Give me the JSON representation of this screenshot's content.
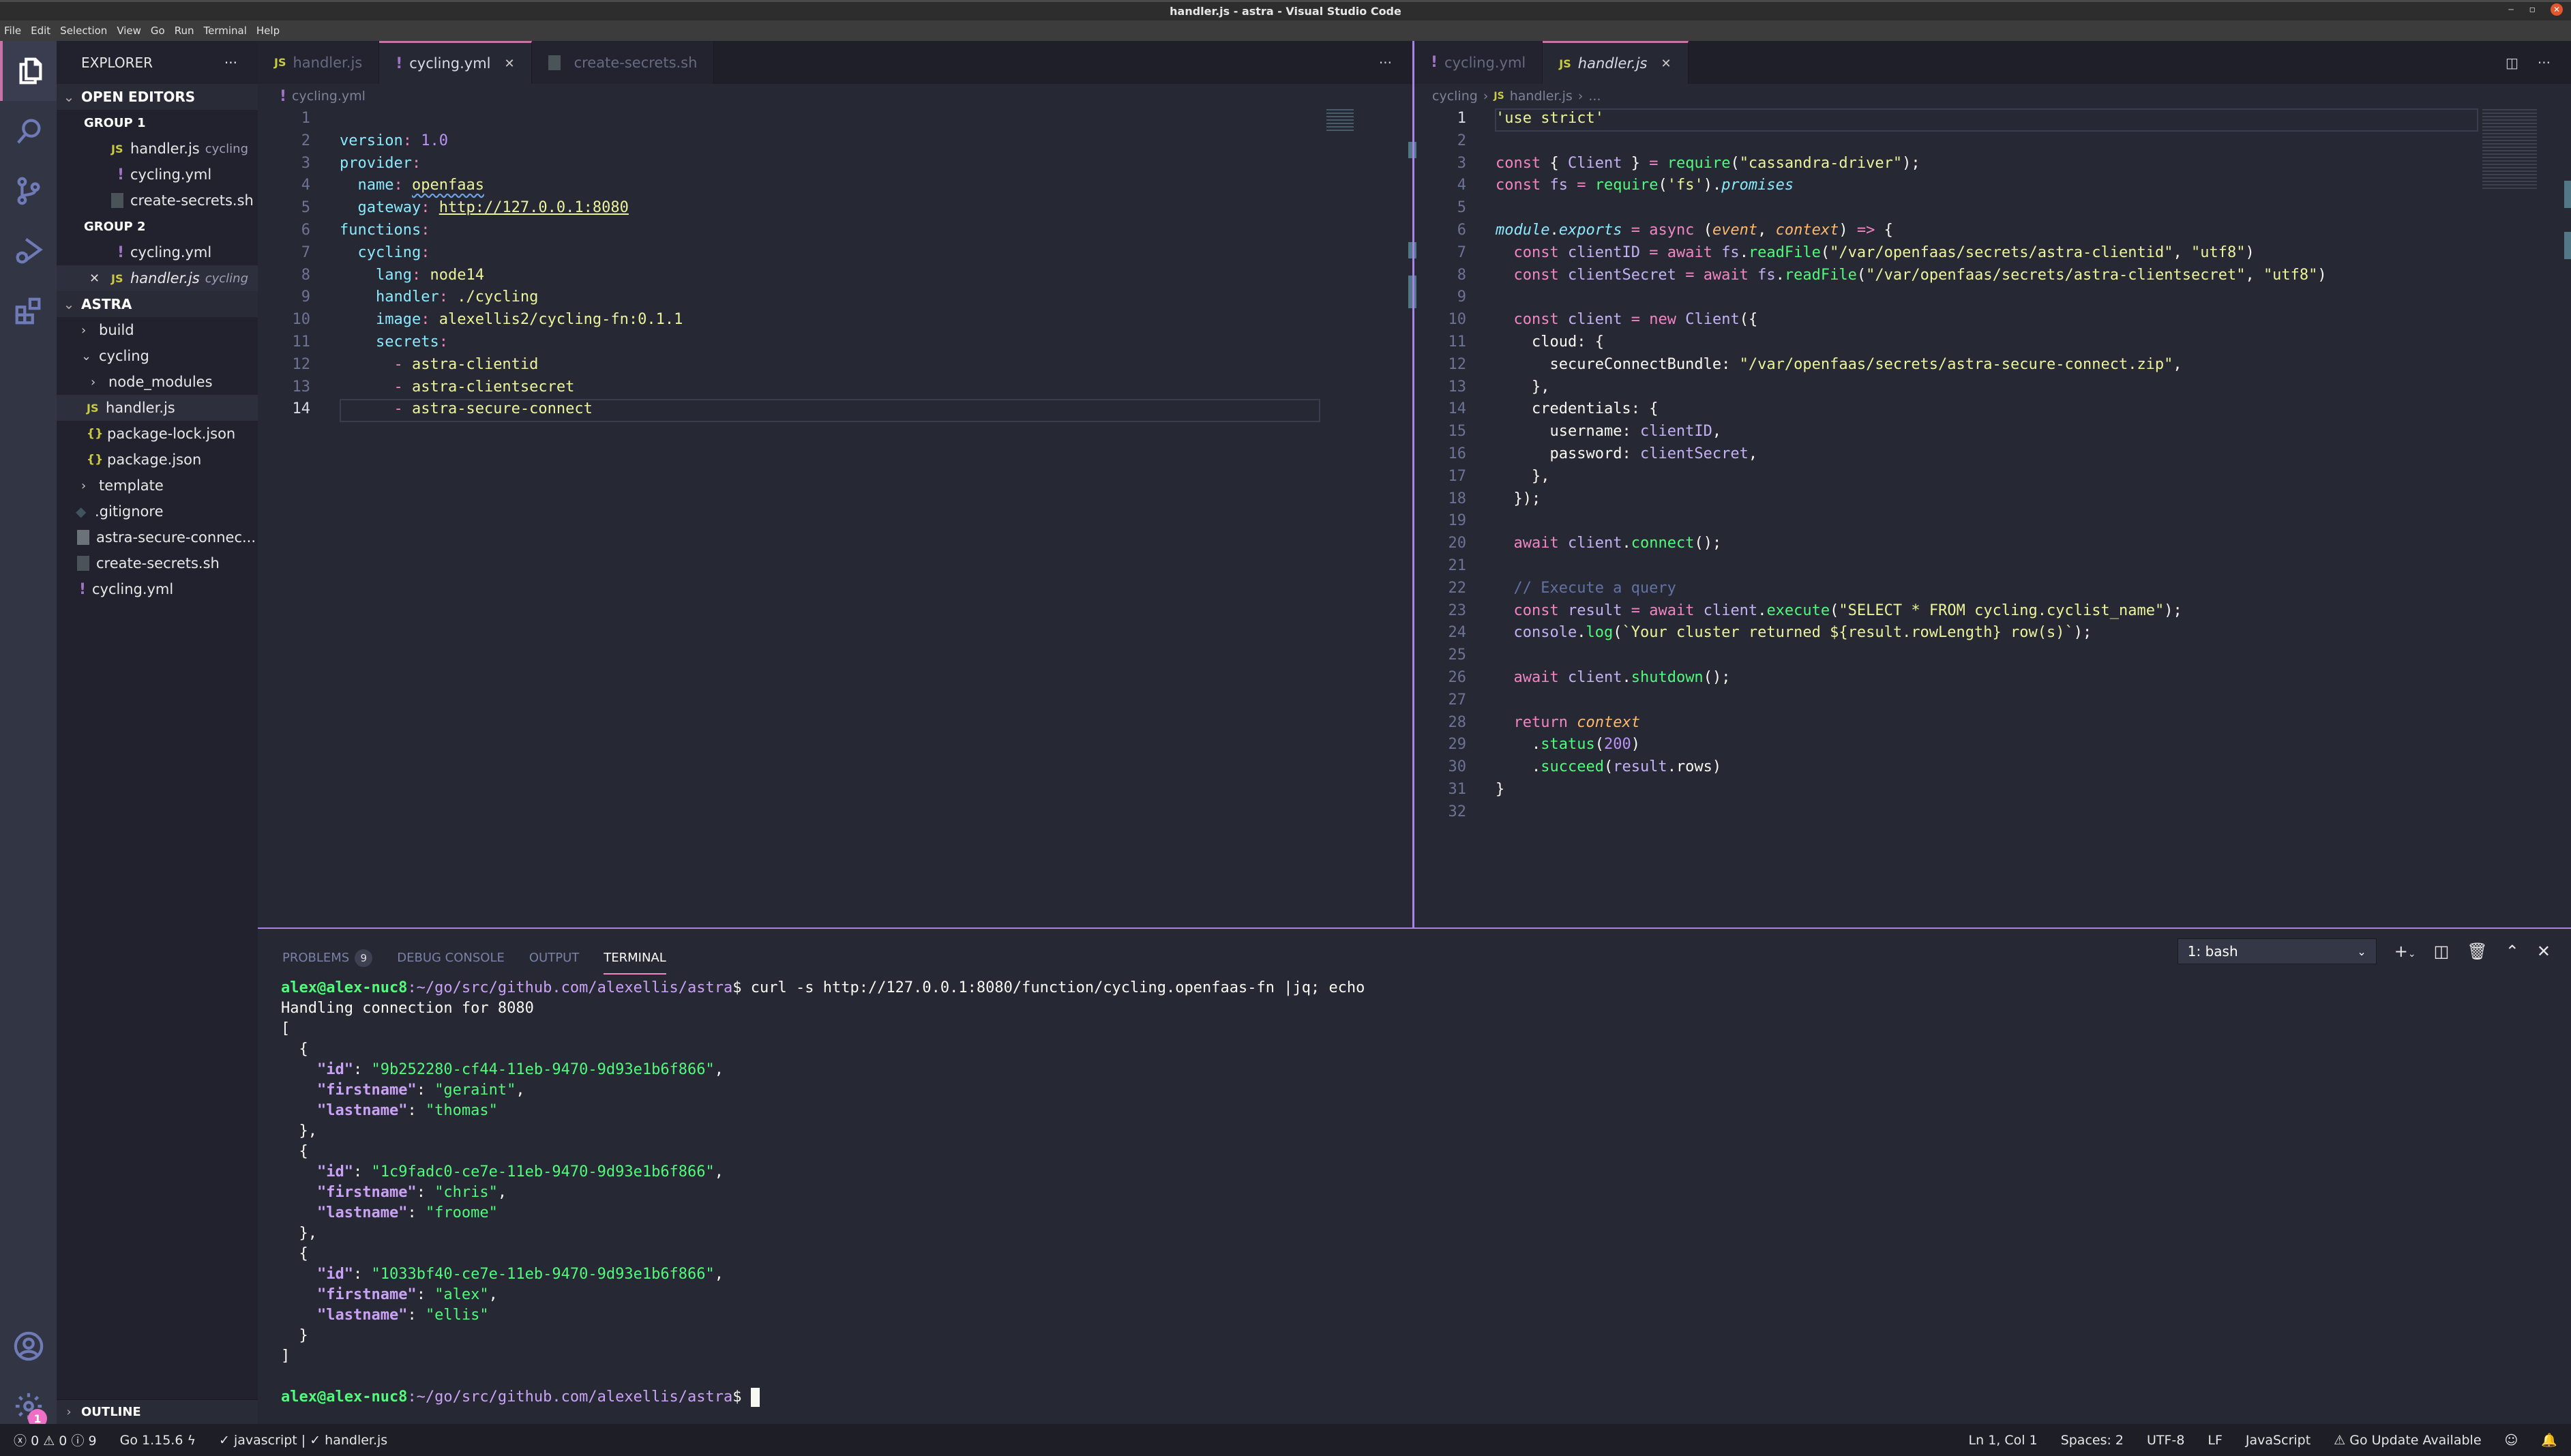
{
  "window": {
    "title": "handler.js - astra - Visual Studio Code",
    "controls": [
      "minimize",
      "maximize",
      "close"
    ]
  },
  "menu": [
    "File",
    "Edit",
    "Selection",
    "View",
    "Go",
    "Run",
    "Terminal",
    "Help"
  ],
  "activity_bar": {
    "items": [
      "explorer-icon",
      "search-icon",
      "source-control-icon",
      "run-debug-icon",
      "extensions-icon"
    ],
    "bottom": [
      "account-icon",
      "settings-gear-icon"
    ],
    "settings_badge": "1"
  },
  "sidebar": {
    "title": "EXPLORER",
    "more": "···",
    "open_editors": {
      "label": "OPEN EDITORS",
      "groups": [
        {
          "label": "GROUP 1",
          "items": [
            {
              "icon": "js",
              "name": "handler.js",
              "desc": "cycling"
            },
            {
              "icon": "yml",
              "name": "cycling.yml",
              "desc": ""
            },
            {
              "icon": "sh",
              "name": "create-secrets.sh",
              "desc": ""
            }
          ]
        },
        {
          "label": "GROUP 2",
          "items": [
            {
              "icon": "yml",
              "name": "cycling.yml",
              "desc": ""
            },
            {
              "icon": "js",
              "name": "handler.js",
              "desc": "cycling",
              "close": "✕"
            }
          ]
        }
      ]
    },
    "workspace": {
      "label": "ASTRA",
      "items": [
        {
          "type": "folder",
          "name": "build",
          "expanded": false
        },
        {
          "type": "folder",
          "name": "cycling",
          "expanded": true
        },
        {
          "type": "folder",
          "name": "node_modules",
          "expanded": false
        },
        {
          "type": "js",
          "name": "handler.js"
        },
        {
          "type": "json",
          "name": "package-lock.json"
        },
        {
          "type": "json",
          "name": "package.json"
        },
        {
          "type": "folder",
          "name": "template",
          "expanded": false
        },
        {
          "type": "git",
          "name": ".gitignore"
        },
        {
          "type": "zip",
          "name": "astra-secure-connec..."
        },
        {
          "type": "sh",
          "name": "create-secrets.sh"
        },
        {
          "type": "yml",
          "name": "cycling.yml"
        }
      ]
    },
    "outline": "OUTLINE"
  },
  "editor_left": {
    "tabs": [
      {
        "icon": "JS",
        "label": "handler.js",
        "active": false
      },
      {
        "icon": "!",
        "label": "cycling.yml",
        "active": true,
        "close": "✕"
      },
      {
        "icon": "sh",
        "label": "create-secrets.sh",
        "active": false
      }
    ],
    "breadcrumb": [
      "cycling.yml"
    ],
    "more": "···",
    "current_line": 14,
    "lines": [
      "1",
      "2",
      "3",
      "4",
      "5",
      "6",
      "7",
      "8",
      "9",
      "10",
      "11",
      "12",
      "13",
      "14"
    ],
    "code": {
      "l1": [
        "version",
        ": ",
        "1.0"
      ],
      "l2": [
        "provider",
        ":"
      ],
      "l3": [
        "  ",
        "name",
        ": ",
        "openfaas"
      ],
      "l4": [
        "  ",
        "gateway",
        ": ",
        "http://127.0.0.1:8080"
      ],
      "l5": [
        "functions",
        ":"
      ],
      "l6": [
        "  ",
        "cycling",
        ":"
      ],
      "l7": [
        "    ",
        "lang",
        ": ",
        "node14"
      ],
      "l8": [
        "    ",
        "handler",
        ": ",
        "./cycling"
      ],
      "l9": [
        "    ",
        "image",
        ": ",
        "alexellis2/cycling-fn:0.1.1"
      ],
      "l10": [
        "    ",
        "secrets",
        ":"
      ],
      "l11": [
        "      ",
        "- ",
        "astra-clientid"
      ],
      "l12": [
        "      ",
        "- ",
        "astra-clientsecret"
      ],
      "l13": [
        "      ",
        "- ",
        "astra-secure-connect"
      ]
    }
  },
  "editor_right": {
    "tabs": [
      {
        "icon": "!",
        "label": "cycling.yml",
        "active": false
      },
      {
        "icon": "JS",
        "label": "handler.js",
        "active": true,
        "close": "✕"
      }
    ],
    "breadcrumb": [
      "cycling",
      "handler.js",
      "..."
    ],
    "more": "···",
    "current_line": 1,
    "lines": [
      "1",
      "2",
      "3",
      "4",
      "5",
      "6",
      "7",
      "8",
      "9",
      "10",
      "11",
      "12",
      "13",
      "14",
      "15",
      "16",
      "17",
      "18",
      "19",
      "20",
      "21",
      "22",
      "23",
      "24",
      "25",
      "26",
      "27",
      "28",
      "29",
      "30",
      "31",
      "32"
    ],
    "code_text": [
      "'use strict'",
      "",
      "const { Client } = require(\"cassandra-driver\");",
      "const fs = require('fs').promises",
      "",
      "module.exports = async (event, context) => {",
      "  const clientID = await fs.readFile(\"/var/openfaas/secrets/astra-clientid\", \"utf8\")",
      "  const clientSecret = await fs.readFile(\"/var/openfaas/secrets/astra-clientsecret\", \"utf8\")",
      "",
      "  const client = new Client({",
      "    cloud: {",
      "      secureConnectBundle: \"/var/openfaas/secrets/astra-secure-connect.zip\",",
      "    },",
      "    credentials: {",
      "      username: clientID,",
      "      password: clientSecret,",
      "    },",
      "  });",
      "",
      "  await client.connect();",
      "",
      "  // Execute a query",
      "  const result = await client.execute(\"SELECT * FROM cycling.cyclist_name\");",
      "  console.log(`Your cluster returned ${result.rowLength} row(s)`);",
      "",
      "  await client.shutdown();",
      "",
      "  return context",
      "    .status(200)",
      "    .succeed(result.rows)",
      "}",
      ""
    ]
  },
  "panel": {
    "tabs": [
      {
        "label": "PROBLEMS",
        "count": "9"
      },
      {
        "label": "DEBUG CONSOLE"
      },
      {
        "label": "OUTPUT"
      },
      {
        "label": "TERMINAL",
        "active": true
      }
    ],
    "terminal_select": "1: bash",
    "controls": [
      "new-terminal",
      "split-terminal",
      "kill-terminal",
      "maximize-panel",
      "close-panel"
    ],
    "terminal": {
      "user_host": "alex@alex-nuc8",
      "path": ":~/go/src/github.com/alexellis/astra",
      "prompt_end": "$ ",
      "command": "curl -s http://127.0.0.1:8080/function/cycling.openfaas-fn |jq; echo",
      "output_line": "Handling connection for 8080",
      "records": [
        {
          "id": "9b252280-cf44-11eb-9470-9d93e1b6f866",
          "firstname": "geraint",
          "lastname": "thomas"
        },
        {
          "id": "1c9fadc0-ce7e-11eb-9470-9d93e1b6f866",
          "firstname": "chris",
          "lastname": "froome"
        },
        {
          "id": "1033bf40-ce7e-11eb-9470-9d93e1b6f866",
          "firstname": "alex",
          "lastname": "ellis"
        }
      ]
    }
  },
  "status_bar": {
    "errors": "0",
    "warnings": "0",
    "infos": "9",
    "go_version": "Go 1.15.6",
    "linters": "✓ javascript | ✓ handler.js",
    "position": "Ln 1, Col 1",
    "spaces": "Spaces: 2",
    "encoding": "UTF-8",
    "eol": "LF",
    "language": "JavaScript",
    "go_update": "Go Update Available"
  }
}
